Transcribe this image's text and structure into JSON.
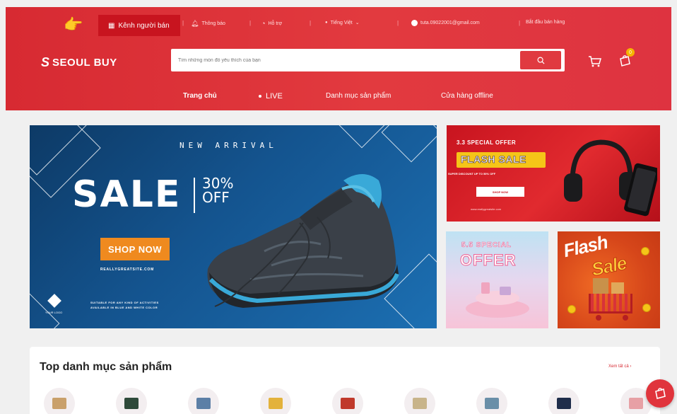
{
  "topbar": {
    "pointer_icon": "hand-pointing-right-icon",
    "seller_channel": "Kênh người bán",
    "notifications": "Thông báo",
    "support": "Hỗ trợ",
    "language": "Tiếng Việt",
    "email": "tuta.09022001@gmail.com",
    "start_selling": "Bắt đầu bán hàng"
  },
  "brand": {
    "name": "SEOUL BUY",
    "mark": "S"
  },
  "search": {
    "placeholder": "Tìm những món đồ yêu thích của bạn"
  },
  "cart": {
    "badge": "0"
  },
  "nav": {
    "home": "Trang chủ",
    "live": "LIVE",
    "categories": "Danh mục sản phẩm",
    "offline_stores": "Cửa hàng offline"
  },
  "banner_main": {
    "new_arrival": "NEW ARRIVAL",
    "sale": "SALE",
    "pct": "30%",
    "off": "OFF",
    "shop_now": "SHOP NOW",
    "site": "REALLYGREATSITE.COM",
    "your_logo": "YOUR LOGO",
    "fine_1": "SUITABLE FOR ANY KIND OF ACTIVITIES",
    "fine_2": "AVAILABLE IN BLUE AND WHITE COLOR"
  },
  "banner_red": {
    "special": "3.3 SPECIAL OFFER",
    "flash": "FLASH SALE",
    "super": "SUPER DISCOUNT UP TO 50% OFF",
    "shop_now": "SHOP NOW",
    "www": "www.reallygreatsite.com"
  },
  "banner_pink": {
    "line1": "5.5 SPECIAL",
    "line2": "OFFER"
  },
  "banner_orange": {
    "line1": "Flash",
    "line2": "Sale"
  },
  "top_categories": {
    "title": "Top danh mục sản phẩm",
    "see_all": "Xem tất cả  ›"
  },
  "colors": {
    "brand_red": "#d72a32",
    "accent_orange": "#ef8a1f",
    "yellow": "#f5c518"
  }
}
